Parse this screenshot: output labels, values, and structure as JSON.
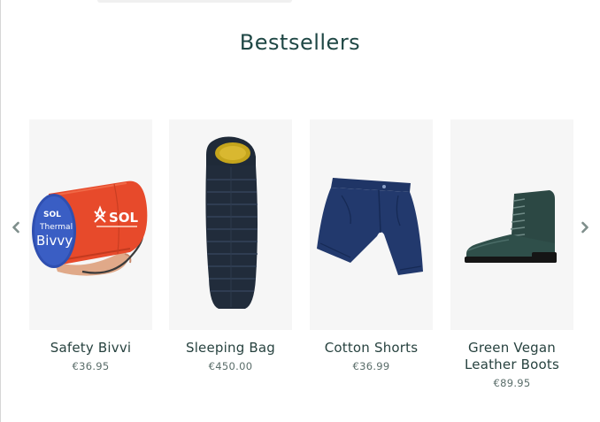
{
  "section": {
    "title": "Bestsellers"
  },
  "products": [
    {
      "name": "Safety Bivvi",
      "price": "€36.95",
      "image": "sol-thermal-bivvy-image",
      "image_text": {
        "brand": "SOL",
        "line1": "Thermal",
        "line2": "Bivvy"
      }
    },
    {
      "name": "Sleeping Bag",
      "price": "€450.00",
      "image": "sleeping-bag-image"
    },
    {
      "name": "Cotton Shorts",
      "price": "€36.99",
      "image": "cotton-shorts-image"
    },
    {
      "name": "Green Vegan Leather Boots",
      "price": "€89.95",
      "image": "leather-boot-image"
    }
  ],
  "carousel": {
    "prev_icon": "chevron-left-icon",
    "next_icon": "chevron-right-icon"
  },
  "colors": {
    "heading": "#1f4745",
    "card_bg": "#f6f6f6",
    "arrow": "#7e8e8b"
  }
}
